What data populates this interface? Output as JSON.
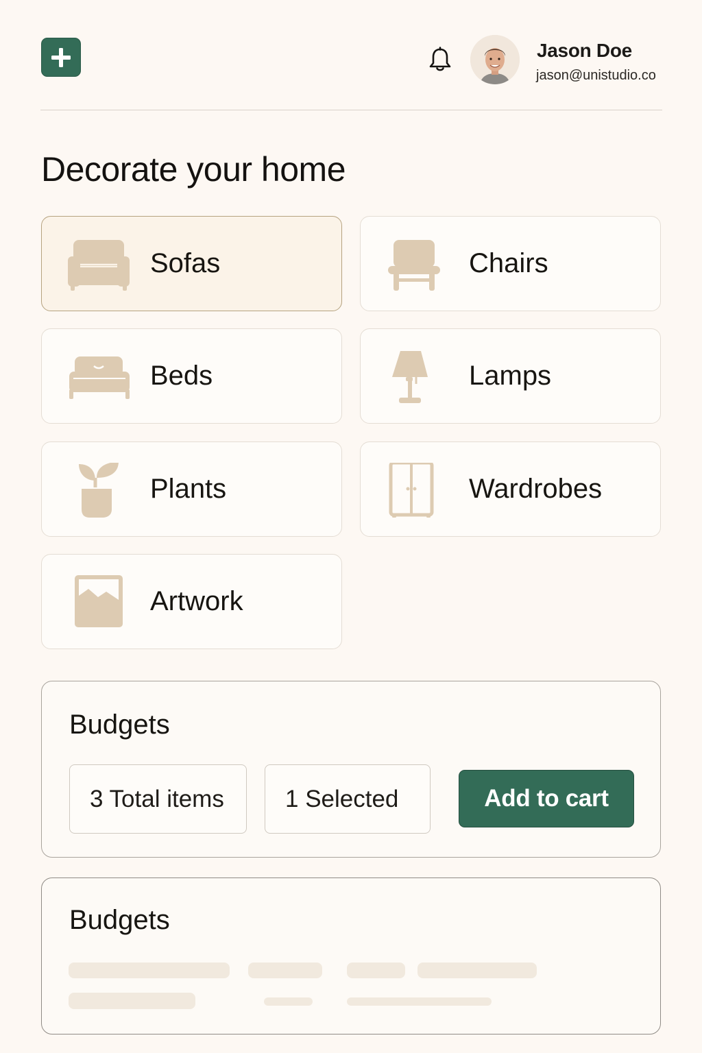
{
  "header": {
    "add_icon": "plus-icon",
    "notification_icon": "bell-icon",
    "user": {
      "name": "Jason Doe",
      "email": "jason@unistudio.co"
    }
  },
  "page": {
    "title": "Decorate your home"
  },
  "categories": [
    {
      "label": "Sofas",
      "icon": "sofa-icon",
      "selected": true
    },
    {
      "label": "Chairs",
      "icon": "chair-icon",
      "selected": false
    },
    {
      "label": "Beds",
      "icon": "bed-icon",
      "selected": false
    },
    {
      "label": "Lamps",
      "icon": "lamp-icon",
      "selected": false
    },
    {
      "label": "Plants",
      "icon": "plant-icon",
      "selected": false
    },
    {
      "label": "Wardrobes",
      "icon": "wardrobe-icon",
      "selected": false
    },
    {
      "label": "Artwork",
      "icon": "artwork-icon",
      "selected": false
    }
  ],
  "budgets": {
    "title": "Budgets",
    "total_items": "3 Total items",
    "selected": "1 Selected",
    "cta": "Add to cart"
  },
  "budgets_placeholder": {
    "title": "Budgets"
  },
  "colors": {
    "accent": "#336c57",
    "background": "#fdf8f3",
    "icon": "#ddcbb2",
    "selected_card": "#fbf3e8"
  }
}
